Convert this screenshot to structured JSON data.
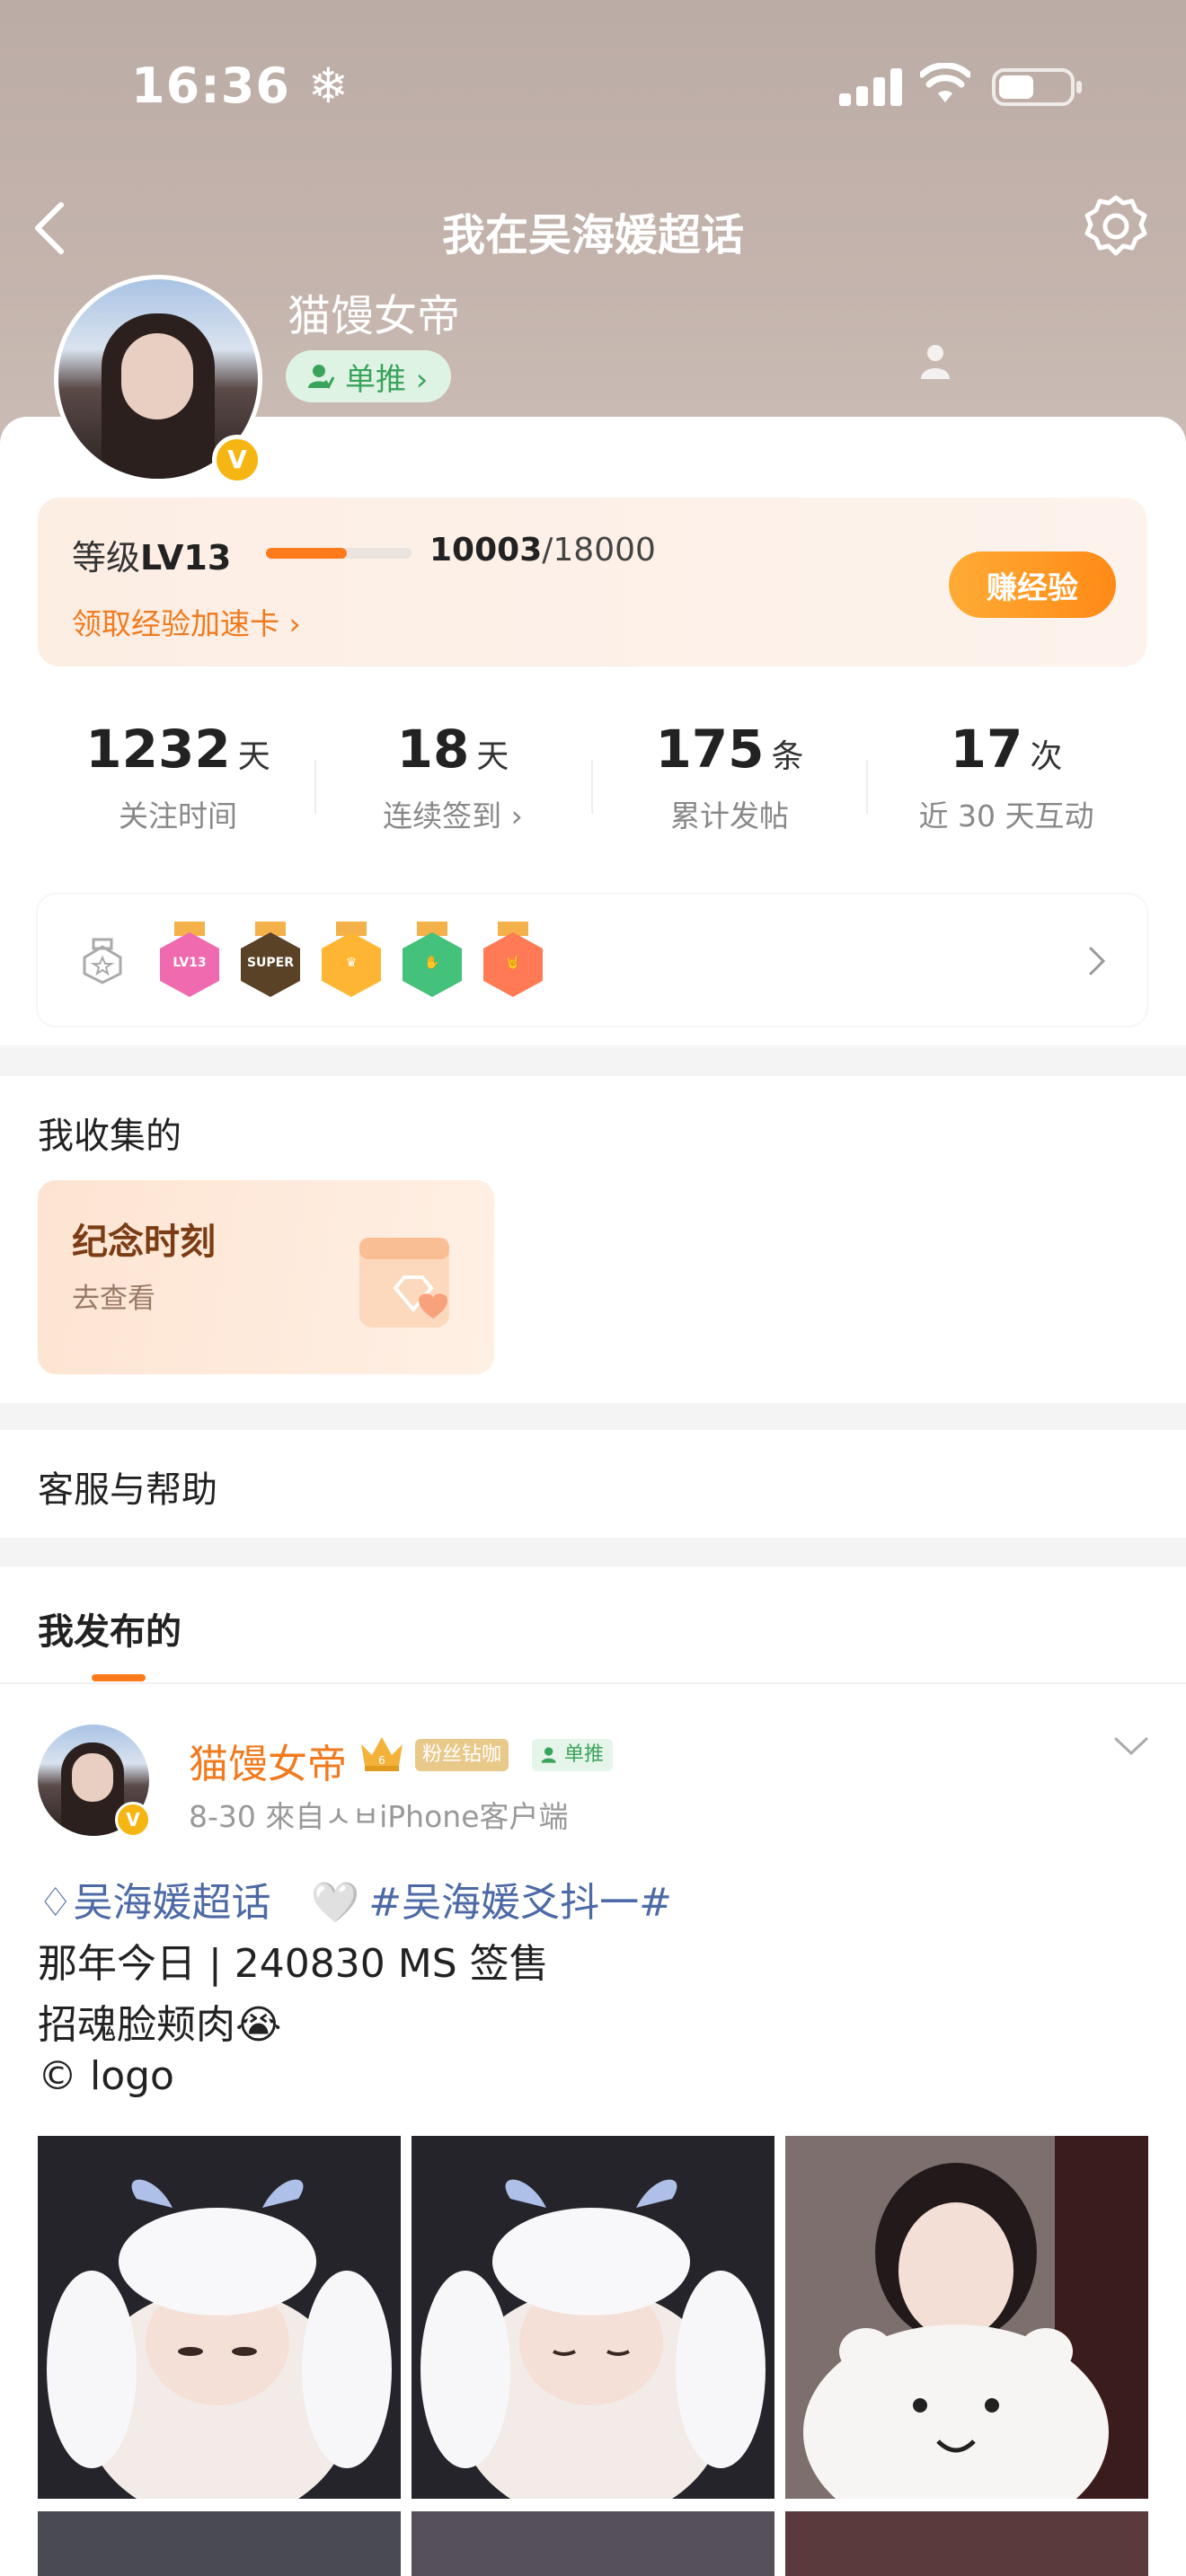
{
  "status_bar": {
    "time": "16:36",
    "time_icon": "snowflake-icon"
  },
  "nav": {
    "title": "我在吴海媛超话",
    "back_icon": "back-arrow-icon",
    "settings_icon": "gear-icon"
  },
  "profile": {
    "name": "猫馒女帝",
    "tag_label": "单推 ›",
    "verified_badge": "V"
  },
  "experience": {
    "level_prefix": "等级",
    "level": "LV13",
    "progress": 0.5557,
    "current": "10003",
    "total": "/18000",
    "boost_link": "领取经验加速卡 ›",
    "earn_button": "赚经验"
  },
  "stats": [
    {
      "value": "1232",
      "unit": "天",
      "label": "关注时间"
    },
    {
      "value": "18",
      "unit": "天",
      "label": "连续签到 ›"
    },
    {
      "value": "175",
      "unit": "条",
      "label": "累计发帖"
    },
    {
      "value": "17",
      "unit": "次",
      "label": "近 30 天互动"
    }
  ],
  "badges": {
    "items": [
      {
        "text": "LV13",
        "color": "#f06ab0"
      },
      {
        "text": "SUPER",
        "color": "#5a4226"
      },
      {
        "text": "",
        "color": "#ffb534"
      },
      {
        "text": "",
        "color": "#44c17a"
      },
      {
        "text": "",
        "color": "#ff7a55"
      }
    ]
  },
  "collected": {
    "title": "我收集的",
    "card_title": "纪念时刻",
    "card_sub": "去查看"
  },
  "help": {
    "title": "客服与帮助"
  },
  "published": {
    "tab_label": "我发布的",
    "post": {
      "author": "猫馒女帝",
      "fan_tag": "粉丝钻咖",
      "single_tag": "单推",
      "meta": "8-30  來自ㅅㅂiPhone客户端",
      "line1_topic": "吴海媛超话",
      "line1_hashtag": "#吴海媛爻抖一#",
      "line2": "那年今日 | 240830 MS 签售",
      "line3": "招魂脸颊肉😭",
      "line4": "© logo"
    }
  },
  "colors": {
    "accent": "#ff7a1a",
    "link_blue": "#4d6aa6",
    "green": "#3aa35c"
  }
}
